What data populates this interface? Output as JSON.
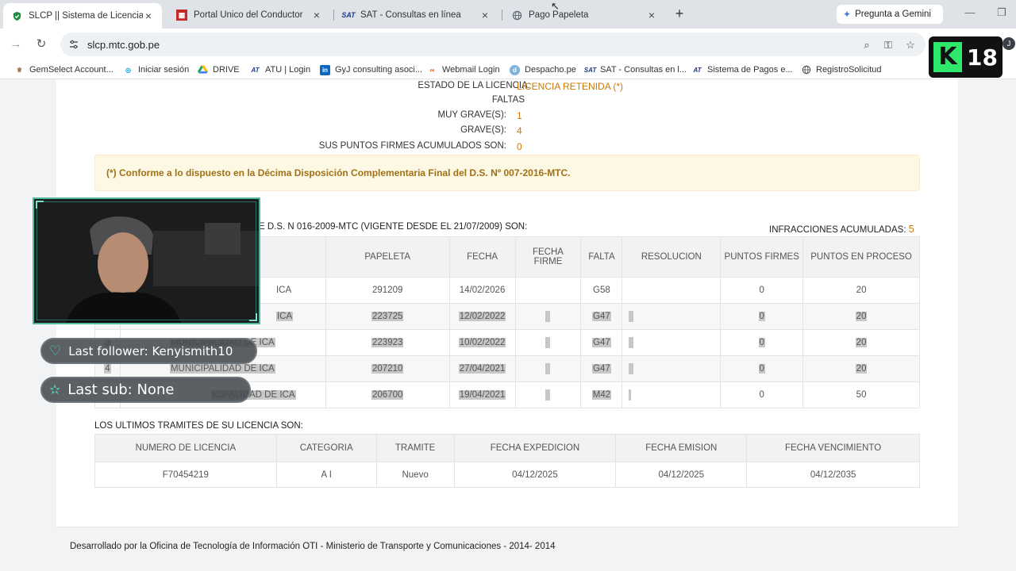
{
  "browser": {
    "tabs": [
      {
        "label": "SLCP || Sistema de Licencias de",
        "icon": "shield-check-icon",
        "active": true
      },
      {
        "label": "Portal Único del Conductor",
        "icon": "mtc-icon",
        "active": false
      },
      {
        "label": "SAT - Consultas en línea",
        "icon": "sat-icon",
        "active": false
      },
      {
        "label": "Pago Papeleta",
        "icon": "globe-icon",
        "active": false
      }
    ],
    "gemini_label": "Pregunta a Gemini",
    "url": "slcp.mtc.gob.pe",
    "profile_initial": "J",
    "bookmarks": [
      {
        "label": "GemSelect Account...",
        "icon": "gemselect-icon"
      },
      {
        "label": "Iniciar sesión",
        "icon": "swirl-icon"
      },
      {
        "label": "DRIVE",
        "icon": "drive-icon"
      },
      {
        "label": "ATU | Login",
        "icon": "atu-icon"
      },
      {
        "label": "GyJ consulting asoci...",
        "icon": "linkedin-icon"
      },
      {
        "label": "Webmail Login",
        "icon": "webmail-icon"
      },
      {
        "label": "Despacho.pe",
        "icon": "despacho-icon"
      },
      {
        "label": "SAT - Consultas en l...",
        "icon": "sat-icon"
      },
      {
        "label": "Sistema de Pagos e...",
        "icon": "atu-icon"
      },
      {
        "label": "RegistroSolicitud",
        "icon": "globe-icon"
      }
    ]
  },
  "license": {
    "estado_label": "ESTADO DE LA LICENCIA:",
    "estado_value": "LICENCIA RETENIDA (*)",
    "faltas_label": "FALTAS",
    "muy_graves_label": "MUY GRAVE(S):",
    "muy_graves_value": "1",
    "graves_label": "GRAVE(S):",
    "graves_value": "4",
    "puntos_label": "SUS PUNTOS FIRMES ACUMULADOS SON:",
    "puntos_value": "0",
    "notice": "(*) Conforme a lo dispuesto en la Décima Disposición Complementaria Final del D.S. Nº 007-2016-MTC."
  },
  "infractions": {
    "title_partial": "E D.S. N 016-2009-MTC (VIGENTE DESDE EL 21/07/2009) SON:",
    "accum_label": "INFRACCIONES ACUMULADAS:",
    "accum_value": "5",
    "columns": [
      "PAPELETA",
      "FECHA",
      "FECHA FIRME",
      "FALTA",
      "RESOLUCION",
      "PUNTOS FIRMES",
      "PUNTOS EN PROCESO"
    ],
    "rows": [
      {
        "num": "",
        "entidad": "ICA",
        "papeleta": "291209",
        "fecha": "14/02/2026",
        "falta": "G58",
        "puntos_firmes": "0",
        "puntos_proceso": "20",
        "selected": false
      },
      {
        "num": "",
        "entidad": "ICA",
        "papeleta": "223725",
        "fecha": "12/02/2022",
        "falta": "G47",
        "puntos_firmes": "0",
        "puntos_proceso": "20",
        "selected": true
      },
      {
        "num": "3",
        "entidad": "MUNICIPALIDAD DE ICA",
        "papeleta": "223923",
        "fecha": "10/02/2022",
        "falta": "G47",
        "puntos_firmes": "0",
        "puntos_proceso": "20",
        "selected": true
      },
      {
        "num": "4",
        "entidad": "MUNICIPALIDAD DE ICA",
        "papeleta": "207210",
        "fecha": "27/04/2021",
        "falta": "G47",
        "puntos_firmes": "0",
        "puntos_proceso": "20",
        "selected": true
      },
      {
        "num": "",
        "entidad": "ICIPALIDAD DE ICA",
        "papeleta": "206700",
        "fecha": "19/04/2021",
        "falta": "M42",
        "puntos_firmes": "0",
        "puntos_proceso": "50",
        "selected": true
      }
    ]
  },
  "tramites": {
    "title": "LOS ULTIMOS TRAMITES DE SU LICENCIA SON:",
    "columns": [
      "NUMERO DE LICENCIA",
      "CATEGORIA",
      "TRAMITE",
      "FECHA EXPEDICION",
      "FECHA EMISION",
      "FECHA VENCIMIENTO"
    ],
    "rows": [
      [
        "F70454219",
        "A I",
        "Nuevo",
        "04/12/2025",
        "04/12/2025",
        "04/12/2035"
      ]
    ]
  },
  "footer": "Desarrollado por la Oficina de Tecnología de Información OTI - Ministerio de Transporte y Comunicaciones - 2014- 2014",
  "stream": {
    "last_follower": "Last follower: Kenyismith10",
    "last_sub": "Last sub: None",
    "rating_letter": "K",
    "rating_number": "18"
  },
  "colors": {
    "accent_value": "#c8790a",
    "notice_bg": "#fcf8e3",
    "stream_teal": "#4fd1b3",
    "rating_green": "#2ee86c"
  }
}
